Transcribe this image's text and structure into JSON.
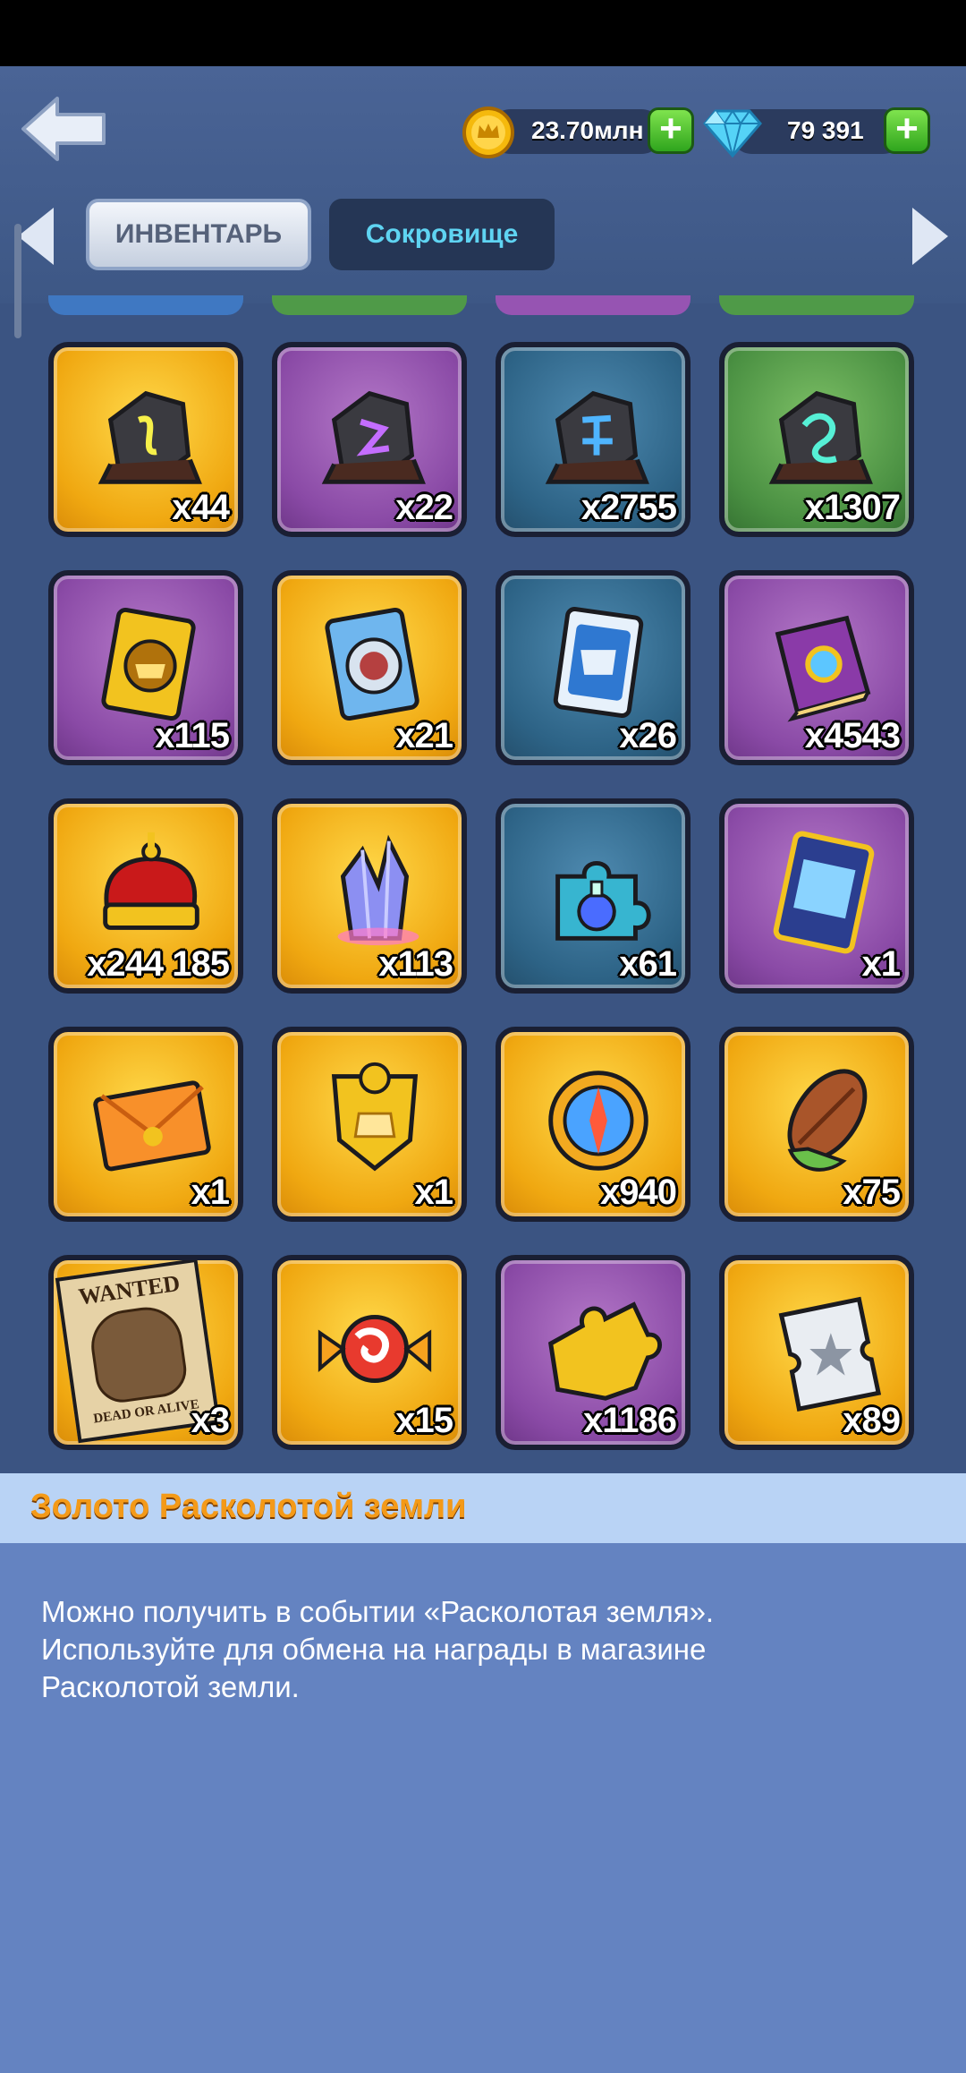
{
  "header": {
    "gold_value": "23.70млн",
    "gems_value": "79 391",
    "tabs": [
      {
        "label": "ИНВЕНТАРЬ",
        "active": true
      },
      {
        "label": "Сокровище",
        "active": false
      }
    ]
  },
  "items": [
    {
      "icon": "rune-stone-gold-icon",
      "bg": "gold",
      "qty": "x44"
    },
    {
      "icon": "rune-stone-purple-icon",
      "bg": "purple",
      "qty": "x22"
    },
    {
      "icon": "rune-stone-blue-icon",
      "bg": "blue",
      "qty": "x2755"
    },
    {
      "icon": "rune-stone-green-icon",
      "bg": "green",
      "qty": "x1307"
    },
    {
      "icon": "hero-card-gold-icon",
      "bg": "purple",
      "qty": "x115"
    },
    {
      "icon": "hero-card-silver-icon",
      "bg": "gold",
      "qty": "x21"
    },
    {
      "icon": "hero-card-blue-icon",
      "bg": "blue",
      "qty": "x26"
    },
    {
      "icon": "spell-book-icon",
      "bg": "purple",
      "qty": "x4543"
    },
    {
      "icon": "crown-icon",
      "bg": "gold",
      "qty": "x244 185"
    },
    {
      "icon": "crystal-icon",
      "bg": "gold",
      "qty": "x113"
    },
    {
      "icon": "potion-puzzle-icon",
      "bg": "blue",
      "qty": "x61"
    },
    {
      "icon": "frame-card-icon",
      "bg": "purple",
      "qty": "x1"
    },
    {
      "icon": "envelope-icon",
      "bg": "gold",
      "qty": "x1"
    },
    {
      "icon": "cake-badge-icon",
      "bg": "gold",
      "qty": "x1"
    },
    {
      "icon": "compass-icon",
      "bg": "gold",
      "qty": "x940"
    },
    {
      "icon": "cocoa-bean-icon",
      "bg": "gold",
      "qty": "x75"
    },
    {
      "icon": "wanted-poster-icon",
      "bg": "gold",
      "qty": "x3",
      "poster_text": [
        "WANTED",
        "DEAD OR ALIVE"
      ]
    },
    {
      "icon": "candy-icon",
      "bg": "gold",
      "qty": "x15"
    },
    {
      "icon": "puzzle-piece-icon",
      "bg": "purple",
      "qty": "x1186"
    },
    {
      "icon": "ticket-icon",
      "bg": "gold",
      "qty": "x89"
    }
  ],
  "selected": {
    "title": "Золото Расколотой земли",
    "description_lines": [
      "Можно получить в событии «Расколотая земля».",
      "Используйте для обмена на награды в магазине",
      "Расколотой земли."
    ]
  },
  "colors": {
    "background": "#3b5482",
    "title": "#f49a18",
    "tab_active_text": "#56627a",
    "tab_inactive_text": "#5fd4f2"
  }
}
